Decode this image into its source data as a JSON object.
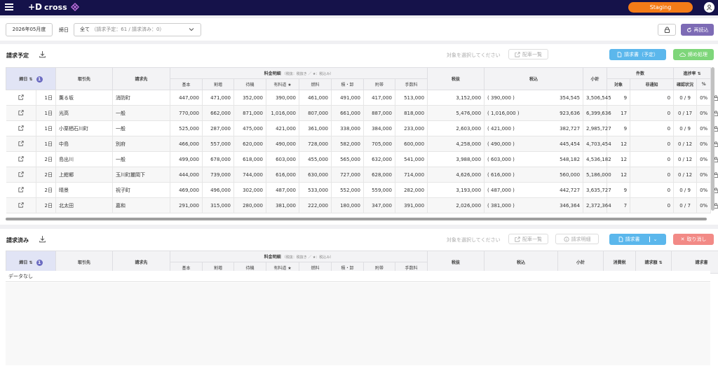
{
  "header": {
    "logo_text": "cross",
    "env_badge": "Staging"
  },
  "toolbar": {
    "month": "2026年05月度",
    "close_label": "締日",
    "select_value": "全て",
    "select_counts": "（請求予定：61 / 請求済み：0）",
    "reload_label": "再読込"
  },
  "pending": {
    "title": "請求予定",
    "hint": "対象を選択してください",
    "dist_list_label": "配車一覧",
    "invoice_label": "請求書（予定）",
    "close_label": "締め処理",
    "headers": {
      "close_day": "締日",
      "sort_badge": "1",
      "partner": "取引先",
      "billing_to": "請求先",
      "fee_group": "料金明細",
      "fee_note": "（税抜：税抜き ／ ★：税込み）",
      "tax_excl": "税抜",
      "tax_incl": "税込",
      "subtotal": "小計",
      "count_group": "件数",
      "progress_group": "進捗率",
      "target": "対象",
      "not_notified": "非通知",
      "confirm_status": "確認状況",
      "pct": "%"
    },
    "fee_cols": [
      "基本",
      "割増",
      "待機",
      "有料道 ★",
      "燃料",
      "積・卸",
      "附帯",
      "手数料"
    ],
    "rows": [
      {
        "day": "1日",
        "partner": "薫る坂",
        "to": "消防町",
        "fees": [
          "447,000",
          "471,000",
          "352,000",
          "390,000",
          "461,000",
          "491,000",
          "417,000",
          "513,000"
        ],
        "excl": "3,152,000",
        "incl_p": "( 390,000 )",
        "incl": "354,545",
        "sub": "3,506,545",
        "target": "9",
        "nn": "0",
        "conf": "0 / 9",
        "pct": "0%"
      },
      {
        "day": "1日",
        "partner": "光高",
        "to": "一般",
        "fees": [
          "770,000",
          "662,000",
          "871,000",
          "1,016,000",
          "807,000",
          "661,000",
          "887,000",
          "818,000"
        ],
        "excl": "5,476,000",
        "incl_p": "( 1,016,000 )",
        "incl": "923,636",
        "sub": "6,399,636",
        "target": "17",
        "nn": "0",
        "conf": "0 / 17",
        "pct": "0%"
      },
      {
        "day": "1日",
        "partner": "小栗栖石川町",
        "to": "一般",
        "fees": [
          "525,000",
          "287,000",
          "475,000",
          "421,000",
          "361,000",
          "338,000",
          "384,000",
          "233,000"
        ],
        "excl": "2,603,000",
        "incl_p": "( 421,000 )",
        "incl": "382,727",
        "sub": "2,985,727",
        "target": "9",
        "nn": "0",
        "conf": "0 / 9",
        "pct": "0%"
      },
      {
        "day": "1日",
        "partner": "中島",
        "to": "別府",
        "fees": [
          "466,000",
          "557,000",
          "620,000",
          "490,000",
          "728,000",
          "582,000",
          "705,000",
          "600,000"
        ],
        "excl": "4,258,000",
        "incl_p": "( 490,000 )",
        "incl": "445,454",
        "sub": "4,703,454",
        "target": "12",
        "nn": "0",
        "conf": "0 / 12",
        "pct": "0%"
      },
      {
        "day": "2日",
        "partner": "島出川",
        "to": "一般",
        "fees": [
          "499,000",
          "678,000",
          "618,000",
          "603,000",
          "455,000",
          "565,000",
          "632,000",
          "541,000"
        ],
        "excl": "3,988,000",
        "incl_p": "( 603,000 )",
        "incl": "548,182",
        "sub": "4,536,182",
        "target": "12",
        "nn": "0",
        "conf": "0 / 12",
        "pct": "0%"
      },
      {
        "day": "2日",
        "partner": "上紺郷",
        "to": "玉川町麗岡下",
        "fees": [
          "444,000",
          "739,000",
          "744,000",
          "616,000",
          "630,000",
          "727,000",
          "628,000",
          "714,000"
        ],
        "excl": "4,626,000",
        "incl_p": "( 616,000 )",
        "incl": "560,000",
        "sub": "5,186,000",
        "target": "12",
        "nn": "0",
        "conf": "0 / 12",
        "pct": "0%"
      },
      {
        "day": "2日",
        "partner": "晴景",
        "to": "祝子町",
        "fees": [
          "469,000",
          "496,000",
          "302,000",
          "487,000",
          "533,000",
          "552,000",
          "559,000",
          "282,000"
        ],
        "excl": "3,193,000",
        "incl_p": "( 487,000 )",
        "incl": "442,727",
        "sub": "3,635,727",
        "target": "9",
        "nn": "0",
        "conf": "0 / 9",
        "pct": "0%"
      },
      {
        "day": "2日",
        "partner": "北太田",
        "to": "嘉和",
        "fees": [
          "291,000",
          "315,000",
          "280,000",
          "381,000",
          "222,000",
          "180,000",
          "347,000",
          "391,000"
        ],
        "excl": "2,026,000",
        "incl_p": "( 381,000 )",
        "incl": "346,364",
        "sub": "2,372,364",
        "target": "7",
        "nn": "0",
        "conf": "0 / 7",
        "pct": "0%"
      }
    ]
  },
  "done": {
    "title": "請求済み",
    "hint": "対象を選択してください",
    "dist_list_label": "配車一覧",
    "details_label": "請求明細",
    "invoice_label": "請求書",
    "cancel_label": "取り消し",
    "headers": {
      "close_day": "締日",
      "sort_badge": "1",
      "partner": "取引先",
      "billing_to": "請求先",
      "fee_group": "料金明細",
      "fee_note": "（税抜：税抜き ／ ★：税込み）",
      "tax_excl": "税抜",
      "tax_incl": "税込",
      "subtotal": "小計",
      "consumption_tax": "消費税",
      "amount": "請求額",
      "invoice": "請求書"
    },
    "fee_cols": [
      "基本",
      "割増",
      "待機",
      "有料道 ★",
      "燃料",
      "積・卸",
      "附帯",
      "手数料"
    ],
    "no_data": "データなし"
  }
}
